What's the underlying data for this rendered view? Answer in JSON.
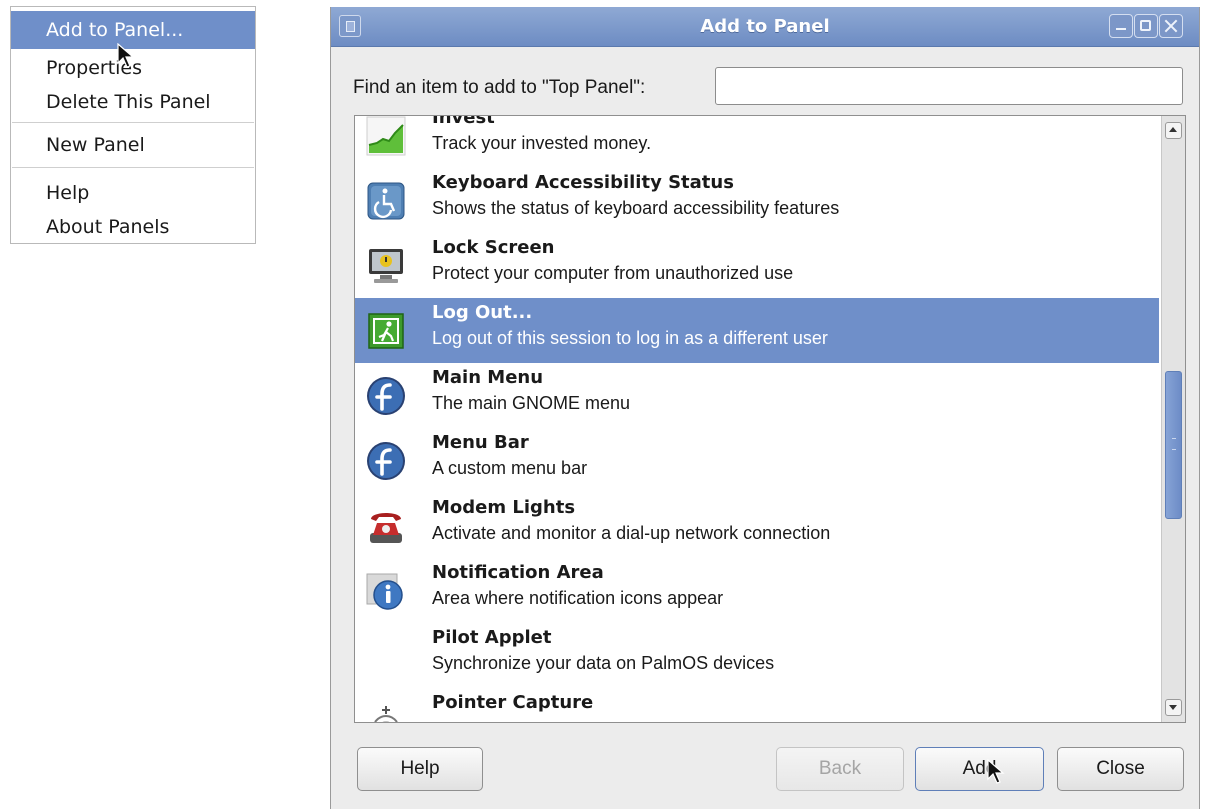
{
  "context_menu": {
    "items": [
      {
        "label": "Add to Panel...",
        "active": true
      },
      {
        "label": "Properties"
      },
      {
        "label": "Delete This Panel"
      },
      {
        "label": "New Panel"
      },
      {
        "label": "Help"
      },
      {
        "label": "About Panels"
      }
    ]
  },
  "dialog": {
    "title": "Add to Panel",
    "find_label": "Find an item to add to \"Top Panel\":",
    "find_value": "",
    "items": [
      {
        "title": "Invest",
        "description": "Track your invested money.",
        "icon": "invest-chart-icon"
      },
      {
        "title": "Keyboard Accessibility Status",
        "description": "Shows the status of keyboard accessibility features",
        "icon": "accessibility-icon"
      },
      {
        "title": "Lock Screen",
        "description": "Protect your computer from unauthorized use",
        "icon": "lock-screen-icon"
      },
      {
        "title": "Log Out...",
        "description": "Log out of this session to log in as a different user",
        "icon": "log-out-icon",
        "selected": true
      },
      {
        "title": "Main Menu",
        "description": "The main GNOME menu",
        "icon": "fedora-logo-icon"
      },
      {
        "title": "Menu Bar",
        "description": "A custom menu bar",
        "icon": "fedora-logo-icon"
      },
      {
        "title": "Modem Lights",
        "description": "Activate and monitor a dial-up network connection",
        "icon": "telephone-icon"
      },
      {
        "title": "Notification Area",
        "description": "Area where notification icons appear",
        "icon": "info-icon"
      },
      {
        "title": "Pilot Applet",
        "description": "Synchronize your data on PalmOS devices",
        "icon": ""
      },
      {
        "title": "Pointer Capture",
        "description": "",
        "icon": "pointer-capture-icon"
      }
    ],
    "buttons": {
      "help": "Help",
      "back": "Back",
      "add": "Add",
      "close": "Close"
    }
  },
  "colors": {
    "selection": "#6f8fc9",
    "titlebar": "#7b97c9"
  }
}
